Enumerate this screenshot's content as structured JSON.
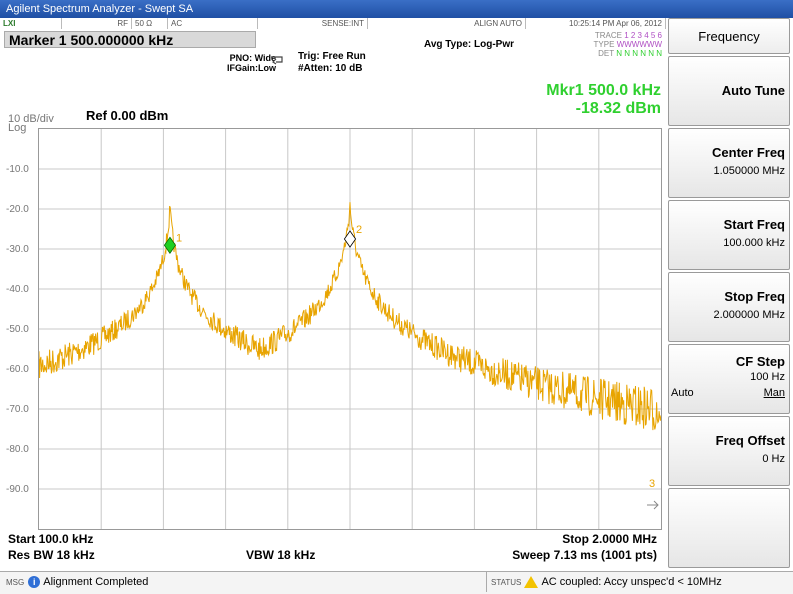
{
  "window": {
    "title": "Agilent Spectrum Analyzer - Swept SA"
  },
  "strip": {
    "logo": "LXI",
    "rf": "RF",
    "impedance": "50 Ω",
    "coupling": "AC",
    "sense": "SENSE:INT",
    "align": "ALIGN AUTO",
    "datetime": "10:25:14 PM Apr 06, 2012"
  },
  "header": {
    "marker_title": "Marker 1 500.000000 kHz",
    "pno": "PNO: Wide",
    "ifgain": "IFGain:Low",
    "trig": "Trig: Free Run",
    "atten": "#Atten: 10 dB",
    "avg_type": "Avg Type: Log-Pwr",
    "trace_label": "TRACE",
    "trace_values": "1 2 3 4 5 6",
    "type_label": "TYPE",
    "type_values": "WWWWWW",
    "det_label": "DET",
    "det_values": "N N N N N N"
  },
  "readout": {
    "marker": "Mkr1 500.0 kHz",
    "level": "-18.32 dBm"
  },
  "scale": {
    "div": "10 dB/div",
    "log": "Log",
    "ref": "Ref 0.00 dBm",
    "ylabels": [
      "-10.0",
      "-20.0",
      "-30.0",
      "-40.0",
      "-50.0",
      "-60.0",
      "-70.0",
      "-80.0",
      "-90.0"
    ]
  },
  "plot": {
    "trace_color": "#e8a400",
    "marker1_label": "1",
    "marker2_label": "2",
    "marker3_label": "3",
    "marker1_freq_khz": 500,
    "marker1_level_dbm": -18.32,
    "marker2_freq_khz": 1050,
    "marker2_level_dbm": -25
  },
  "footer": {
    "start": "Start 100.0 kHz",
    "res_bw": "Res BW 18 kHz",
    "vbw": "VBW 18 kHz",
    "stop": "Stop 2.0000 MHz",
    "sweep": "Sweep  7.13 ms (1001 pts)"
  },
  "msgbar": {
    "msg_label": "MSG",
    "message": "Alignment Completed",
    "status_label": "STATUS",
    "status_message": "AC coupled: Accy unspec'd < 10MHz"
  },
  "softkeys": {
    "menu_title": "Frequency",
    "auto_tune": "Auto Tune",
    "center_freq": "Center Freq",
    "center_freq_val": "1.050000 MHz",
    "start_freq": "Start Freq",
    "start_freq_val": "100.000 kHz",
    "stop_freq": "Stop Freq",
    "stop_freq_val": "2.000000 MHz",
    "cf_step": "CF Step",
    "cf_step_val": "100 Hz",
    "cf_auto": "Auto",
    "cf_man": "Man",
    "freq_offset": "Freq Offset",
    "freq_offset_val": "0 Hz"
  }
}
